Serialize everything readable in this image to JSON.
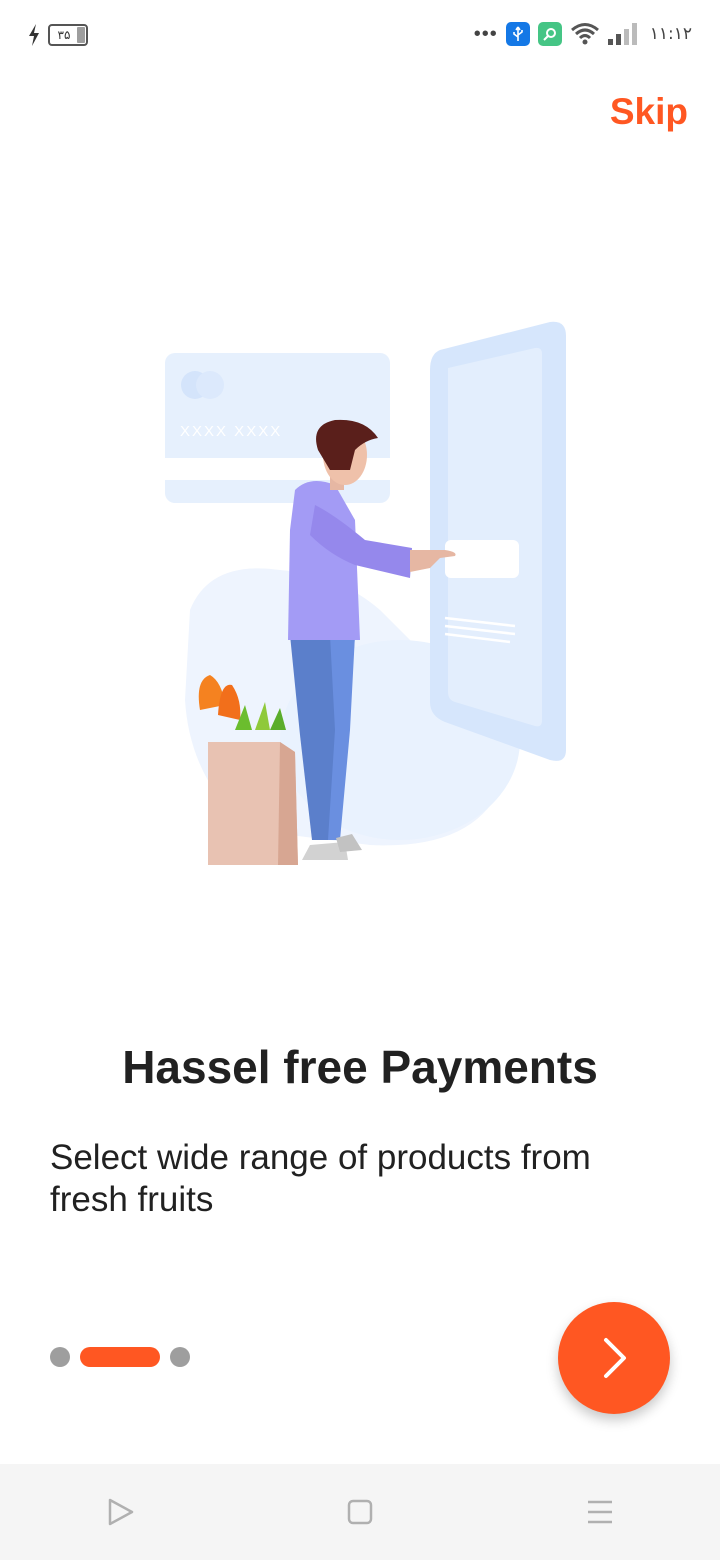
{
  "status_bar": {
    "battery_level": "۳۵",
    "time": "۱۱:۱۲",
    "more_icon": "more-dots-icon",
    "usb_icon": "usb-icon",
    "app_icon": "app-notification-icon",
    "wifi_icon": "wifi-icon",
    "signal_icon": "signal-icon",
    "charging_icon": "charging-icon"
  },
  "header": {
    "skip_label": "Skip"
  },
  "illustration": {
    "card_number_text": "XXXX XXXX"
  },
  "onboarding": {
    "title": "Hassel free Payments",
    "description": "Select wide range of products from fresh fruits",
    "pages_total": 3,
    "active_page": 2
  },
  "next_button": {
    "icon": "chevron-right-icon"
  },
  "nav_bar": {
    "back_icon": "triangle-back-icon",
    "home_icon": "square-home-icon",
    "menu_icon": "menu-lines-icon"
  },
  "colors": {
    "accent": "#ff5722",
    "text": "#212121",
    "inactive_dot": "#9e9e9e",
    "illustration_blue": "#dbe9fd"
  }
}
